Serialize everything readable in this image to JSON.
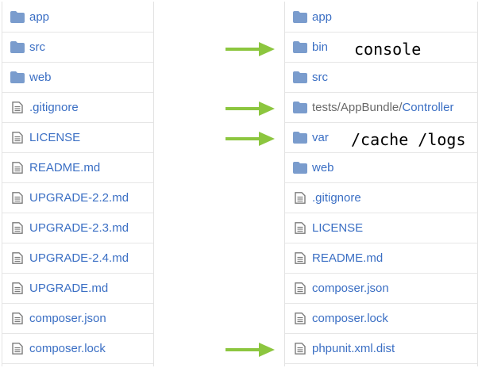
{
  "left_listing": [
    {
      "name": "app",
      "type": "folder"
    },
    {
      "name": "src",
      "type": "folder"
    },
    {
      "name": "web",
      "type": "folder"
    },
    {
      "name": ".gitignore",
      "type": "file"
    },
    {
      "name": "LICENSE",
      "type": "file"
    },
    {
      "name": "README.md",
      "type": "file"
    },
    {
      "name": "UPGRADE-2.2.md",
      "type": "file"
    },
    {
      "name": "UPGRADE-2.3.md",
      "type": "file"
    },
    {
      "name": "UPGRADE-2.4.md",
      "type": "file"
    },
    {
      "name": "UPGRADE.md",
      "type": "file"
    },
    {
      "name": "composer.json",
      "type": "file"
    },
    {
      "name": "composer.lock",
      "type": "file"
    }
  ],
  "right_listing": [
    {
      "name": "app",
      "type": "folder"
    },
    {
      "name": "bin",
      "type": "folder"
    },
    {
      "name": "src",
      "type": "folder"
    },
    {
      "name": "tests/AppBundle/Controller",
      "type": "folder",
      "path_parts": [
        "tests/",
        "AppBundle/",
        "Controller"
      ]
    },
    {
      "name": "var",
      "type": "folder"
    },
    {
      "name": "web",
      "type": "folder"
    },
    {
      "name": ".gitignore",
      "type": "file"
    },
    {
      "name": "LICENSE",
      "type": "file"
    },
    {
      "name": "README.md",
      "type": "file"
    },
    {
      "name": "composer.json",
      "type": "file"
    },
    {
      "name": "composer.lock",
      "type": "file"
    },
    {
      "name": "phpunit.xml.dist",
      "type": "file"
    }
  ],
  "annotations": {
    "bin_note": "console",
    "var_note": "/cache /logs"
  },
  "colors": {
    "link": "#3b6fc4",
    "folder_icon": "#7a9ccd",
    "file_icon": "#7b7b7b",
    "arrow": "#8cc63f",
    "muted": "#6a6a6a"
  },
  "icons": {
    "folder": "folder-icon",
    "file": "file-icon",
    "arrow": "arrow-right-icon"
  }
}
